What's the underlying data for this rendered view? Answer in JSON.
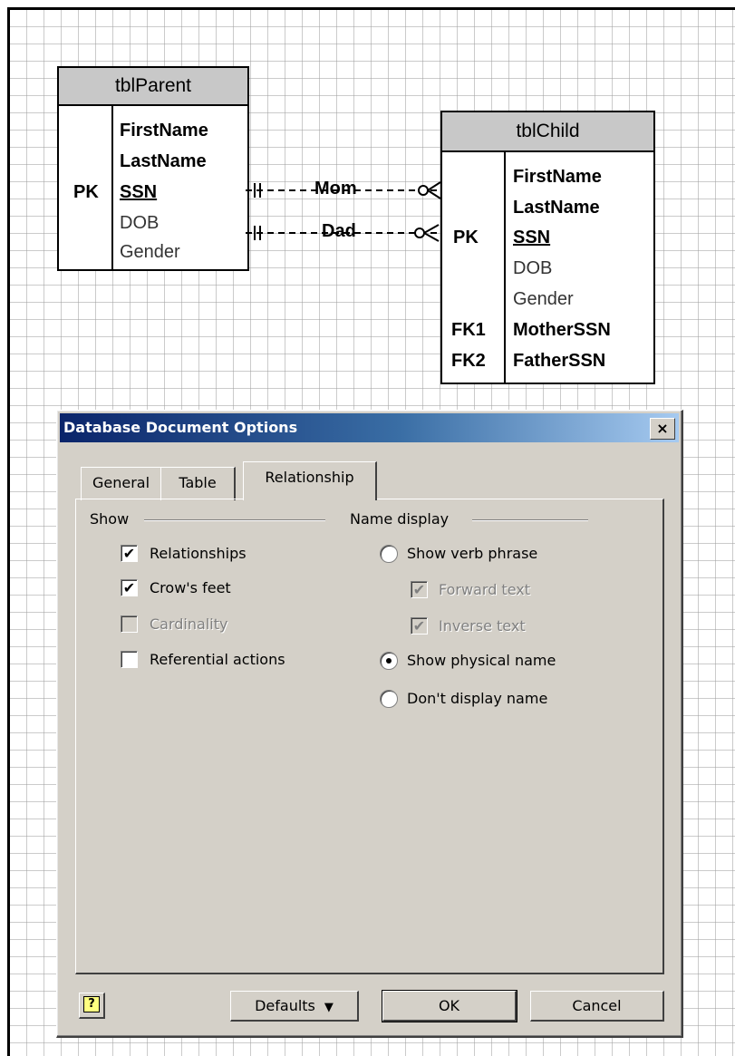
{
  "diagram": {
    "parent_table": {
      "name": "tblParent",
      "keys": [
        "PK"
      ],
      "fields": [
        "FirstName",
        "LastName",
        "SSN",
        "DOB",
        "Gender"
      ]
    },
    "child_table": {
      "name": "tblChild",
      "keys": [
        "PK",
        "FK1",
        "FK2"
      ],
      "fields": [
        "FirstName",
        "LastName",
        "SSN",
        "DOB",
        "Gender",
        "MotherSSN",
        "FatherSSN"
      ]
    },
    "relationships": [
      {
        "label": "Mom"
      },
      {
        "label": "Dad"
      }
    ]
  },
  "dialog": {
    "title": "Database Document Options",
    "close_glyph": "×",
    "tabs": [
      {
        "label": "General"
      },
      {
        "label": "Table"
      },
      {
        "label": "Relationship"
      }
    ],
    "active_tab": "Relationship",
    "show_group": {
      "label": "Show",
      "options": [
        {
          "label": "Relationships",
          "checked": true,
          "enabled": true
        },
        {
          "label": "Crow's feet",
          "checked": true,
          "enabled": true
        },
        {
          "label": "Cardinality",
          "checked": false,
          "enabled": false
        },
        {
          "label": "Referential actions",
          "checked": false,
          "enabled": true
        }
      ]
    },
    "name_group": {
      "label": "Name display",
      "verb_phrase": {
        "label": "Show verb phrase",
        "selected": false
      },
      "forward_text": {
        "label": "Forward text",
        "checked": true,
        "enabled": false
      },
      "inverse_text": {
        "label": "Inverse text",
        "checked": true,
        "enabled": false
      },
      "physical_name": {
        "label": "Show physical name",
        "selected": true
      },
      "no_name": {
        "label": "Don't display name",
        "selected": false
      }
    },
    "buttons": {
      "help_glyph": "?",
      "defaults": "Defaults",
      "defaults_arrow": "▼",
      "ok": "OK",
      "cancel": "Cancel"
    }
  },
  "colors": {
    "dialog_face": "#d4d0c8",
    "titlebar_start": "#0a246a",
    "titlebar_end": "#a6caf0",
    "table_header": "#c8c8c8"
  }
}
